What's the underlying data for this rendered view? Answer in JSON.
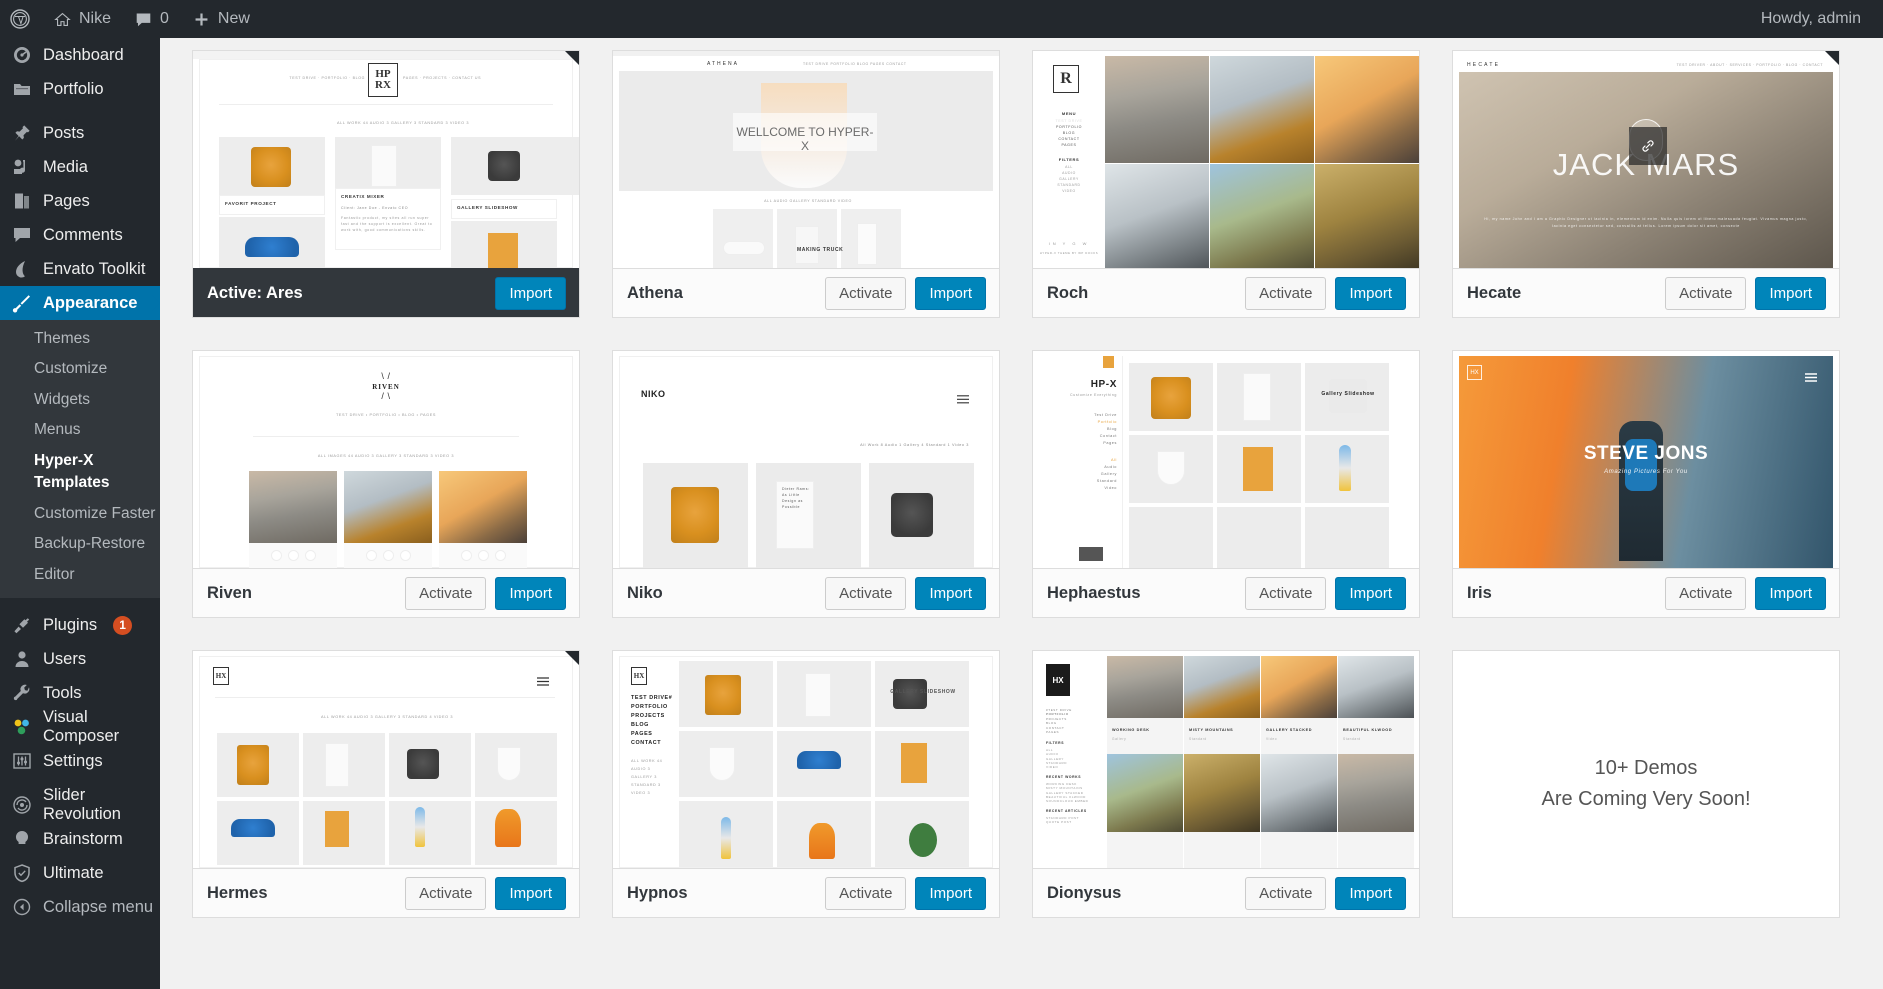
{
  "adminbar": {
    "wp_logo": "wordpress-logo-icon",
    "site_name": "Nike",
    "comments_icon": "comment-icon",
    "comments_count": "0",
    "new_label": "New",
    "howdy": "Howdy, admin"
  },
  "sidebar": {
    "items": [
      {
        "label": "Dashboard",
        "icon": "dashboard-icon",
        "current": false
      },
      {
        "label": "Portfolio",
        "icon": "portfolio-folder-icon",
        "current": false
      },
      {
        "label": "Posts",
        "icon": "pin-icon",
        "current": false
      },
      {
        "label": "Media",
        "icon": "media-icon",
        "current": false
      },
      {
        "label": "Pages",
        "icon": "pages-icon",
        "current": false
      },
      {
        "label": "Comments",
        "icon": "comment-icon",
        "current": false
      },
      {
        "label": "Envato Toolkit",
        "icon": "envato-leaf-icon",
        "current": false
      },
      {
        "label": "Appearance",
        "icon": "paintbrush-icon",
        "current": true
      },
      {
        "label": "Plugins",
        "icon": "plug-icon",
        "current": false,
        "badge": "1"
      },
      {
        "label": "Users",
        "icon": "user-icon",
        "current": false
      },
      {
        "label": "Tools",
        "icon": "wrench-icon",
        "current": false
      },
      {
        "label": "Visual Composer",
        "icon": "visual-composer-icon",
        "current": false
      },
      {
        "label": "Settings",
        "icon": "settings-sliders-icon",
        "current": false
      },
      {
        "label": "Slider Revolution",
        "icon": "slider-revolution-icon",
        "current": false
      },
      {
        "label": "Brainstorm",
        "icon": "brainstorm-bulb-icon",
        "current": false
      },
      {
        "label": "Ultimate",
        "icon": "ultimate-shield-icon",
        "current": false
      },
      {
        "label": "Collapse menu",
        "icon": "collapse-arrow-icon",
        "current": false
      }
    ],
    "submenu": [
      {
        "label": "Themes",
        "current": false
      },
      {
        "label": "Customize",
        "current": false
      },
      {
        "label": "Widgets",
        "current": false
      },
      {
        "label": "Menus",
        "current": false
      },
      {
        "label": "Hyper-X Templates",
        "current": true
      },
      {
        "label": "Customize Faster",
        "current": false
      },
      {
        "label": "Backup-Restore",
        "current": false
      },
      {
        "label": "Editor",
        "current": false
      }
    ]
  },
  "buttons": {
    "activate": "Activate",
    "import": "Import"
  },
  "themes": [
    {
      "name": "Active: Ares",
      "active": true,
      "mock": "ares",
      "mock_text": {
        "logo_top": "HP",
        "logo_bottom": "RX",
        "nav_left": "TEST DRIVE · PORTFOLIO · BLOG",
        "nav_right": "PAGES · PROJECTS · CONTACT US",
        "filters": "ALL WORK 44   AUDIO 3   GALLERY 3   STANDARD 3   VIDEO 3",
        "t1": "FAVORIT PROJECT",
        "t2": "CREATIX MIXER",
        "t3": "GALLERY SLIDESHOW",
        "b1": "Client: Jane Doe - Envato CEO",
        "b2": "Fantastic product, my sites all run super fast and the support is excellent. Great to work with, good communications skills."
      }
    },
    {
      "name": "Athena",
      "active": false,
      "mock": "athena",
      "mock_text": {
        "logo": "ATHENA",
        "nav": "TEST DRIVE   PORTFOLIO   BLOG   PAGES   CONTACT",
        "hero": "WELLCOME TO HYPER-X",
        "filters": "ALL   AUDIO   GALLERY   STANDARD   VIDEO",
        "card_text": "MAKING TRUCK"
      }
    },
    {
      "name": "Roch",
      "active": false,
      "mock": "roch",
      "mock_text": {
        "logo": "R",
        "menu_title": "MENU",
        "menu": "TEST DRIVE|PORTFOLIO|BLOG|CONTACT|PAGES",
        "filters_title": "FILTERS",
        "filters": "ALL|AUDIO|GALLERY|STANDARD|VIDEO",
        "footer": "HYPER-X THEME BY WP DOCKS"
      }
    },
    {
      "name": "Hecate",
      "active": false,
      "mock": "hecate",
      "mock_text": {
        "logo": "HECATE",
        "nav": "TEST DRIVER · ABOUT · SERVICES · PORTFOLIO · BLOG · CONTACT",
        "hero": "JACK MARS",
        "sub": "Hi, my name John and I am a Graphic Designer ut lacinia in, elementum id enim. Nulla quis lorem ut libero malesuada feugiat. Vivamus magna justo, lacinia eget consectetur sed, convallis at tellus. Lorem ipsum dolor sit amet, consecte",
        "badge": "link-icon"
      }
    },
    {
      "name": "Riven",
      "active": false,
      "mock": "riven",
      "mock_text": {
        "logo": "RIVEN",
        "nav": "TEST DRIVE • PORTFOLIO • BLOG • PAGES",
        "filters": "ALL IMAGES 44   AUDIO 3   GALLERY 3   STANDARD 3   VIDEO 3",
        "likes": [
          "3",
          "1",
          "2"
        ]
      }
    },
    {
      "name": "Niko",
      "active": false,
      "mock": "niko",
      "mock_text": {
        "logo": "NIKO",
        "menu_icon": "hamburger-icon",
        "filters": "All Work 8   Audio 1   Gallery 4   Standard 1   Video 3",
        "book_text": "Dieter Rams: As Little Design as Possible"
      }
    },
    {
      "name": "Hephaestus",
      "active": false,
      "mock": "hephaestus",
      "mock_text": {
        "logo": "HP-X",
        "tagline": "Customize Everything",
        "menu": "Test Drive|Portfolio|Blog|Contact|Pages",
        "filters": "All|Audio|Gallery|Standard|Video",
        "overlay": "Gallery Slideshow"
      }
    },
    {
      "name": "Iris",
      "active": false,
      "mock": "iris",
      "mock_text": {
        "logo": "HX",
        "menu_icon": "hamburger-icon",
        "hero": "STEVE JONS",
        "sub": "Amazing Pictures For You"
      }
    },
    {
      "name": "Hermes",
      "active": false,
      "mock": "hermes",
      "mock_text": {
        "logo": "HX",
        "menu_icon": "hamburger-icon",
        "filters": "ALL WORK 44   AUDIO 3   GALLERY 3   STANDARD 4   VIDEO 3"
      }
    },
    {
      "name": "Hypnos",
      "active": false,
      "mock": "hypnos",
      "mock_text": {
        "logo": "HX",
        "menu": "TEST DRIVE#|PORTFOLIO|PROJECTS|BLOG|PAGES|CONTACT",
        "filters": "ALL WORK 44|AUDIO 3|GALLERY 3|STANDARD 3|VIDEO 3",
        "overlay": "GALLERY SLIDESHOW"
      }
    },
    {
      "name": "Dionysus",
      "active": false,
      "mock": "dionysus",
      "mock_text": {
        "logo": "HX",
        "menu": "#TEST DRIVE|PORTFOLIO|PROJECTS|BLOG|CONTACT|PAGES",
        "filters_title": "FILTERS",
        "filters": "ALL|AUDIO|GALLERY|STANDARD|VIDEO",
        "recent_title": "RECENT WORKS",
        "recent": "WORKING DESK|MISTY MOUNTAINS|GALLERY STACKED|BEAUTIFUL KLWOOD|SOUNDCLOUD EMBED",
        "articles_title": "RECENT ARTICLES",
        "articles": "STANDARD POST|QUOTE POST",
        "tiles": [
          {
            "t": "WORKING DESK",
            "s": "Gallery"
          },
          {
            "t": "MISTY MOUNTAINS",
            "s": "Standard"
          },
          {
            "t": "GALLERY STACKED",
            "s": "Video"
          },
          {
            "t": "BEAUTIFUL KLWOOD",
            "s": "Standard"
          }
        ]
      }
    }
  ],
  "coming_soon": {
    "line1": "10+ Demos",
    "line2": "Are Coming Very Soon!"
  },
  "colors": {
    "admin_dark": "#23282d",
    "submenu_dark": "#32373c",
    "accent_blue": "#0073aa",
    "button_blue": "#0085ba",
    "badge_orange": "#d54e21",
    "page_bg": "#f1f1f1"
  }
}
